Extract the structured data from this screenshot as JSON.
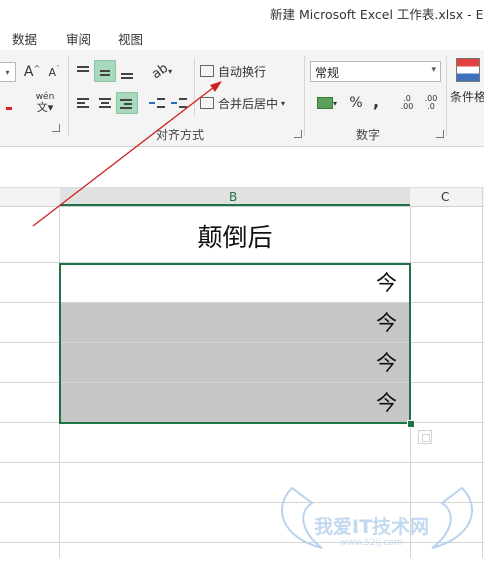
{
  "window": {
    "title": "新建 Microsoft Excel 工作表.xlsx - Exc"
  },
  "tabs": [
    "数据",
    "审阅",
    "视图"
  ],
  "ribbon": {
    "font": {
      "grow_label": "A",
      "shrink_label": "A",
      "phonetic_label": "wén"
    },
    "alignment": {
      "wrap_text_label": "自动换行",
      "merge_center_label": "合并后居中",
      "group_label": "对齐方式"
    },
    "number": {
      "format_value": "常规",
      "percent_label": "%",
      "comma_label": ",",
      "inc_decimal_label": ".0 .00",
      "dec_decimal_label": ".00 .0",
      "group_label": "数字"
    },
    "styles": {
      "conditional_label": "条件格"
    }
  },
  "grid": {
    "columns": [
      "B",
      "C"
    ],
    "header_cell": "颠倒后",
    "rows": [
      {
        "text": "今",
        "highlighted": false
      },
      {
        "text": "今",
        "highlighted": true
      },
      {
        "text": "今",
        "highlighted": true
      },
      {
        "text": "今",
        "highlighted": true
      }
    ],
    "selected_column": "B",
    "highlight_color": "#c6c6c6",
    "selection_color": "#217346"
  },
  "annotation": {
    "arrow_color": "#cc2222"
  },
  "watermark": {
    "text": "我爱IT技术网",
    "url": "www.52ij.com"
  }
}
